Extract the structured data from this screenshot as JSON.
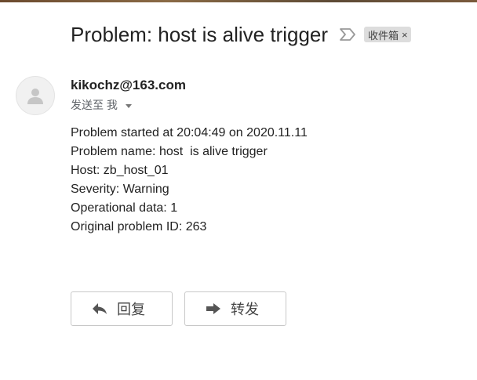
{
  "email": {
    "subject": "Problem: host is alive trigger",
    "label_chip": {
      "text": "收件箱",
      "close": "×"
    },
    "sender": "kikochz@163.com",
    "recipient_text": "发送至 我",
    "body_lines": [
      "Problem started at 20:04:49 on 2020.11.11",
      "Problem name: host  is alive trigger",
      "Host: zb_host_01",
      "Severity: Warning",
      "Operational data: 1",
      "Original problem ID: 263"
    ]
  },
  "actions": {
    "reply_label": "回复",
    "forward_label": "转发"
  },
  "icons": {
    "importance": "importance-marker-icon",
    "avatar": "default-avatar-icon",
    "reply": "reply-arrow-icon",
    "forward": "forward-arrow-icon",
    "details_caret": "chevron-down-icon"
  }
}
